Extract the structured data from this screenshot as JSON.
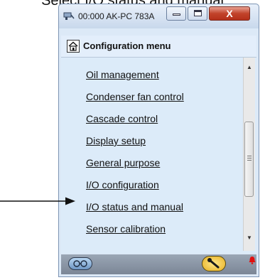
{
  "caption": "Select I/O status and manual",
  "window": {
    "title": "00:000 AK-PC 783A",
    "close_glyph": "X",
    "icons": {
      "app": "network-plug-icon",
      "minimize": "minimize-icon",
      "maximize": "maximize-icon"
    }
  },
  "menu": {
    "title": "Configuration menu",
    "home_icon": "home-icon",
    "items": [
      "Oil management",
      "Condenser fan control",
      "Cascade control",
      "Display setup",
      "General purpose",
      "I/O configuration",
      "I/O status and manual",
      "Sensor calibration"
    ],
    "highlighted_index": 6
  },
  "scrollbar": {
    "up_glyph": "▲",
    "down_glyph": "▼"
  },
  "statusbar": {
    "icons": [
      "glasses-icon",
      "wrench-icon",
      "alarm-bell-icon"
    ]
  },
  "colors": {
    "content_bg": "#dcebf9",
    "close_button": "#c2432b",
    "alarm": "#e01010"
  }
}
